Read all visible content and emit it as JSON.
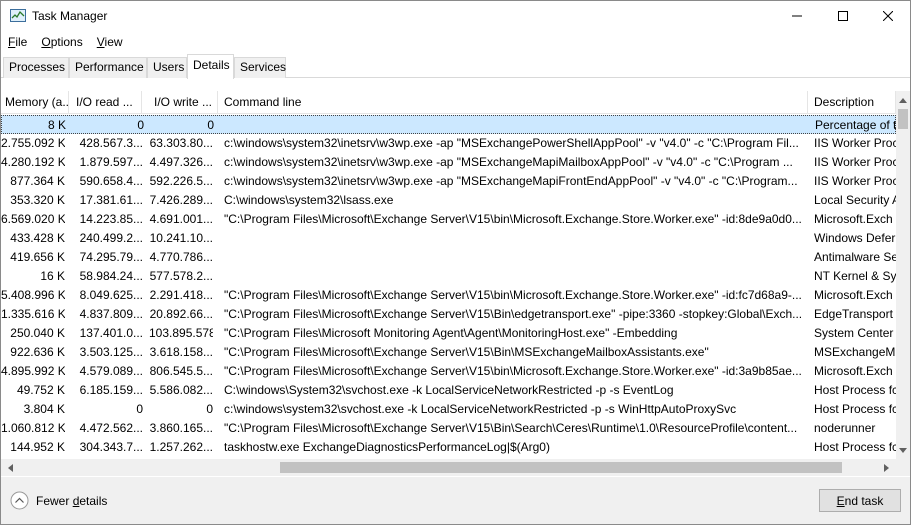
{
  "window": {
    "title": "Task Manager",
    "controls": {
      "minimize": "minimize-icon",
      "maximize": "maximize-icon",
      "close": "close-icon"
    }
  },
  "menu": [
    {
      "label": "File",
      "accel": "F",
      "rest": "ile"
    },
    {
      "label": "Options",
      "accel": "O",
      "rest": "ptions"
    },
    {
      "label": "View",
      "accel": "V",
      "rest": "iew"
    }
  ],
  "tabs": [
    "Processes",
    "Performance",
    "Users",
    "Details",
    "Services"
  ],
  "active_tab": "Details",
  "columns": [
    "Memory (a...",
    "I/O read ...",
    "I/O write ...",
    "Command line",
    "Description"
  ],
  "rows": [
    [
      "8 K",
      "0",
      "0",
      "",
      "Percentage of t"
    ],
    [
      "2.755.092 K",
      "428.567.3...",
      "63.303.80...",
      "c:\\windows\\system32\\inetsrv\\w3wp.exe -ap \"MSExchangePowerShellAppPool\" -v \"v4.0\" -c \"C:\\Program Fil...",
      "IIS Worker Proc"
    ],
    [
      "4.280.192 K",
      "1.879.597...",
      "4.497.326...",
      "c:\\windows\\system32\\inetsrv\\w3wp.exe -ap \"MSExchangeMapiMailboxAppPool\" -v \"v4.0\" -c \"C:\\Program ...",
      "IIS Worker Proc"
    ],
    [
      "877.364 K",
      "590.658.4...",
      "592.226.5...",
      "c:\\windows\\system32\\inetsrv\\w3wp.exe -ap \"MSExchangeMapiFrontEndAppPool\" -v \"v4.0\" -c \"C:\\Program...",
      "IIS Worker Proc"
    ],
    [
      "353.320 K",
      "17.381.61...",
      "7.426.289...",
      "C:\\windows\\system32\\lsass.exe",
      "Local Security A"
    ],
    [
      "6.569.020 K",
      "14.223.85...",
      "4.691.001...",
      "\"C:\\Program Files\\Microsoft\\Exchange Server\\V15\\bin\\Microsoft.Exchange.Store.Worker.exe\" -id:8de9a0d0...",
      "Microsoft.Exch"
    ],
    [
      "433.428 K",
      "240.499.2...",
      "10.241.10...",
      "",
      "Windows Defer"
    ],
    [
      "419.656 K",
      "74.295.79...",
      "4.770.786...",
      "",
      "Antimalware Se"
    ],
    [
      "16 K",
      "58.984.24...",
      "577.578.2...",
      "",
      "NT Kernel & Sy"
    ],
    [
      "5.408.996 K",
      "8.049.625...",
      "2.291.418...",
      "\"C:\\Program Files\\Microsoft\\Exchange Server\\V15\\bin\\Microsoft.Exchange.Store.Worker.exe\" -id:fc7d68a9-...",
      "Microsoft.Exch"
    ],
    [
      "1.335.616 K",
      "4.837.809...",
      "20.892.66...",
      "\"C:\\Program Files\\Microsoft\\Exchange Server\\V15\\Bin\\edgetransport.exe\" -pipe:3360 -stopkey:Global\\Exch...",
      "EdgeTransport"
    ],
    [
      "250.040 K",
      "137.401.0...",
      "103.895.578",
      "\"C:\\Program Files\\Microsoft Monitoring Agent\\Agent\\MonitoringHost.exe\" -Embedding",
      "System Center"
    ],
    [
      "922.636 K",
      "3.503.125...",
      "3.618.158...",
      "\"C:\\Program Files\\Microsoft\\Exchange Server\\V15\\Bin\\MSExchangeMailboxAssistants.exe\"",
      "MSExchangeM"
    ],
    [
      "4.895.992 K",
      "4.579.089...",
      "806.545.5...",
      "\"C:\\Program Files\\Microsoft\\Exchange Server\\V15\\bin\\Microsoft.Exchange.Store.Worker.exe\" -id:3a9b85ae...",
      "Microsoft.Exch"
    ],
    [
      "49.752 K",
      "6.185.159...",
      "5.586.082...",
      "C:\\windows\\System32\\svchost.exe -k LocalServiceNetworkRestricted -p -s EventLog",
      "Host Process fc"
    ],
    [
      "3.804 K",
      "0",
      "0",
      "c:\\windows\\system32\\svchost.exe -k LocalServiceNetworkRestricted -p -s WinHttpAutoProxySvc",
      "Host Process fc"
    ],
    [
      "1.060.812 K",
      "4.472.562...",
      "3.860.165...",
      "\"C:\\Program Files\\Microsoft\\Exchange Server\\V15\\Bin\\Search\\Ceres\\Runtime\\1.0\\ResourceProfile\\content...",
      "noderunner"
    ],
    [
      "144.952 K",
      "304.343.7...",
      "1.257.262...",
      "taskhostw.exe ExchangeDiagnosticsPerformanceLog|$(Arg0)",
      "Host Process fc"
    ]
  ],
  "selected_row": 0,
  "footer": {
    "fewer_details": "Fewer details",
    "fewer_accel": "d",
    "end_task": "End task",
    "end_accel": "E"
  }
}
